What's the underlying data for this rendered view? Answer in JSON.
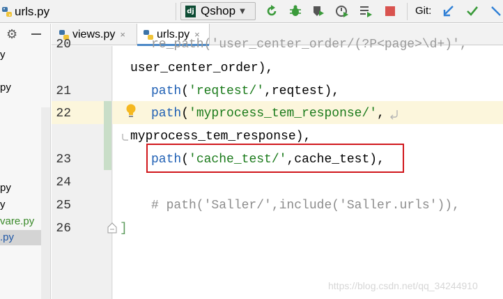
{
  "toolbar": {
    "file_name": "urls.py",
    "run_config": "Qshop",
    "git_label": "Git:",
    "buttons": [
      "rerun-icon",
      "debug-icon",
      "coverage-icon",
      "profile-icon",
      "concurrency-icon",
      "stop-icon"
    ],
    "git_buttons": [
      "update-project-icon",
      "commit-icon"
    ]
  },
  "project_panel": {
    "items": [
      {
        "label": "y",
        "color": "black"
      },
      {
        "label": "py",
        "color": "black"
      },
      {
        "label": "py",
        "color": "black"
      },
      {
        "label": "y",
        "color": "black"
      },
      {
        "label": "vare.py",
        "color": "green"
      },
      {
        "label": ".py",
        "color": "blue",
        "selected": true
      }
    ]
  },
  "tabs": [
    {
      "label": "views.py",
      "close": "×"
    },
    {
      "label": "urls.py",
      "close": "×",
      "active": true
    }
  ],
  "editor": {
    "lines": [
      {
        "num": "20",
        "text_fn": "re_path",
        "text_rest": "('user_center_order/(?P<page>\\d+)',"
      },
      {
        "num": "",
        "text": "user_center_order),"
      },
      {
        "num": "21",
        "fn": "path",
        "open": "(",
        "str": "'reqtest/'",
        "rest": ",reqtest),"
      },
      {
        "num": "22",
        "fn": "path",
        "open": "(",
        "str": "'myprocess_tem_response/'",
        "rest": ","
      },
      {
        "num": "",
        "text": "myprocess_tem_response),"
      },
      {
        "num": "23",
        "fn": "path",
        "open": "(",
        "str": "'cache_test/'",
        "rest": ",cache_test),"
      },
      {
        "num": "24",
        "text": ""
      },
      {
        "num": "25",
        "comment": "# path('Saller/',include('Saller.urls')),"
      },
      {
        "num": "26",
        "text": "]"
      }
    ]
  },
  "watermark": "https://blog.csdn.net/qq_34244910",
  "colors": {
    "highlight_box": "#d0161b",
    "current_line": "#fcf6dc",
    "function": "#1e5fb4",
    "string": "#1a7a1a",
    "comment": "#8c8c8c"
  }
}
